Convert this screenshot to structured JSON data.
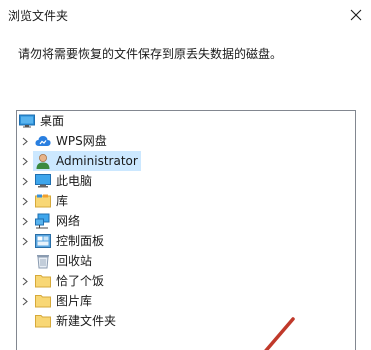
{
  "window": {
    "title": "浏览文件夹",
    "close_icon": "close-icon"
  },
  "instruction": "请勿将需要恢复的文件保存到原丢失数据的磁盘。",
  "tree": {
    "root": {
      "label": "桌面",
      "icon": "desktop-icon"
    },
    "items": [
      {
        "label": "WPS网盘",
        "icon": "cloud-icon",
        "expandable": true,
        "selected": false
      },
      {
        "label": "Administrator",
        "icon": "user-icon",
        "expandable": true,
        "selected": true
      },
      {
        "label": "此电脑",
        "icon": "computer-icon",
        "expandable": true,
        "selected": false
      },
      {
        "label": "库",
        "icon": "library-icon",
        "expandable": true,
        "selected": false
      },
      {
        "label": "网络",
        "icon": "network-icon",
        "expandable": true,
        "selected": false
      },
      {
        "label": "控制面板",
        "icon": "control-panel-icon",
        "expandable": true,
        "selected": false
      },
      {
        "label": "回收站",
        "icon": "recycle-bin-icon",
        "expandable": false,
        "selected": false
      },
      {
        "label": "恰了个饭",
        "icon": "folder-icon",
        "expandable": true,
        "selected": false
      },
      {
        "label": "图片库",
        "icon": "folder-icon",
        "expandable": true,
        "selected": false
      },
      {
        "label": "新建文件夹",
        "icon": "folder-icon",
        "expandable": false,
        "selected": false
      }
    ]
  },
  "colors": {
    "selection": "#cce8ff",
    "folder": "#f8d775",
    "annotation": "#c0392b"
  }
}
